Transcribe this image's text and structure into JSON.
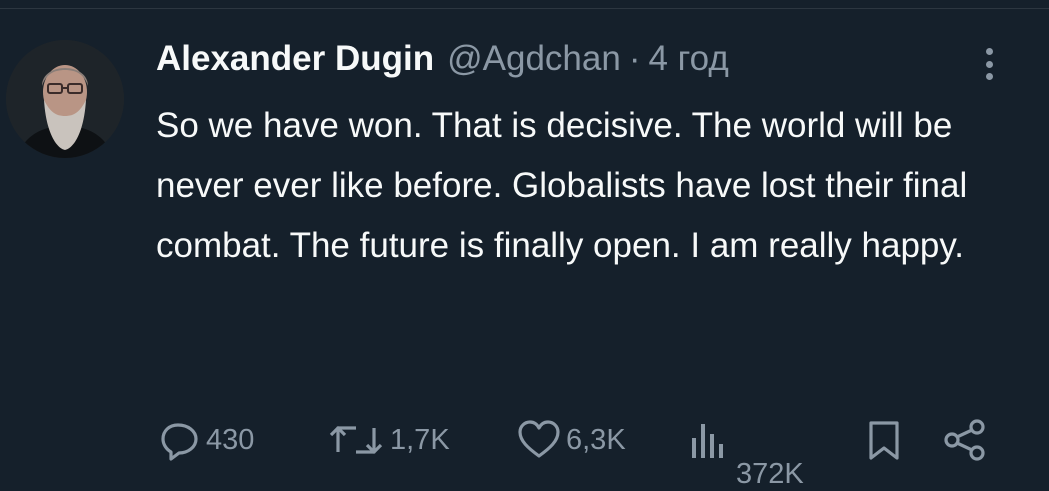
{
  "tweet": {
    "author_name": "Alexander Dugin",
    "handle": "@Agdchan",
    "separator": "·",
    "time": "4 год",
    "text": "So we have won. That is decisive. The world will be never ever like before. Globalists have lost their final combat. The future is finally open. I am really happy."
  },
  "actions": {
    "replies": "430",
    "reposts": "1,7K",
    "likes": "6,3K",
    "views": "372K"
  },
  "colors": {
    "background": "#15202b",
    "text": "#f7f9f9",
    "secondary": "#8b98a5"
  },
  "icons": [
    "more-icon",
    "reply-icon",
    "repost-icon",
    "like-icon",
    "views-icon",
    "bookmark-icon",
    "share-icon"
  ]
}
